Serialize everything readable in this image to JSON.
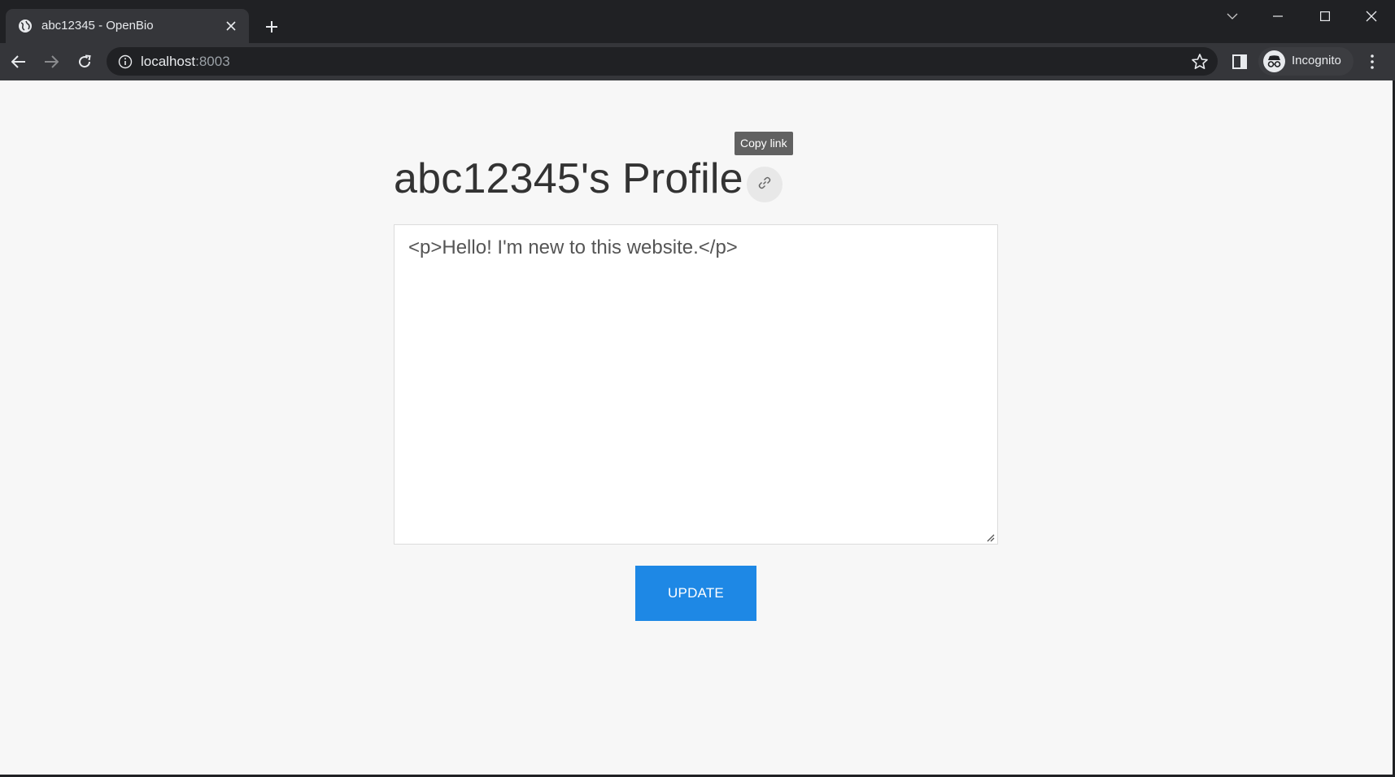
{
  "browser": {
    "tab": {
      "title": "abc12345 - OpenBio",
      "favicon": "globe-icon"
    },
    "address": {
      "host": "localhost",
      "port": ":8003"
    },
    "profile_label": "Incognito"
  },
  "page": {
    "tooltip": "Copy link",
    "title": "abc12345's Profile",
    "bio_value": "<p>Hello! I'm new to this website.</p>",
    "update_label": "UPDATE"
  },
  "colors": {
    "accent": "#1e88e5",
    "page_background": "#f7f7f7",
    "chrome_dark": "#202124"
  }
}
